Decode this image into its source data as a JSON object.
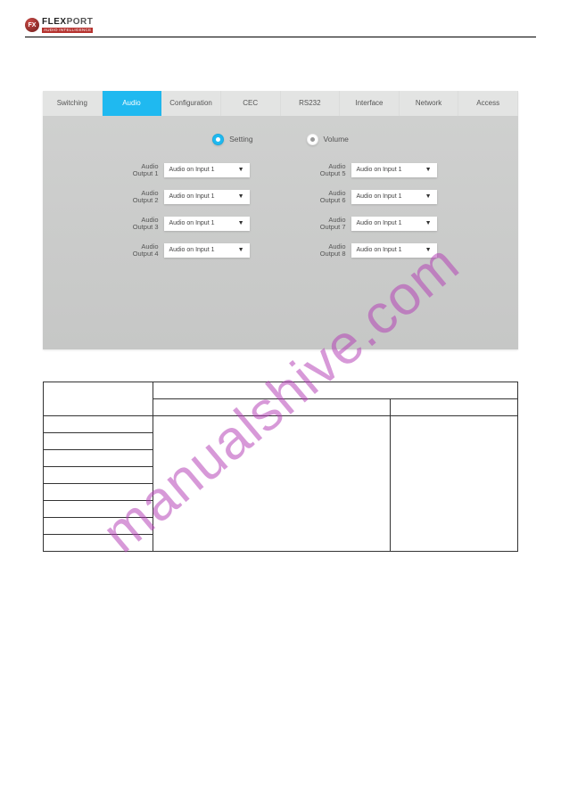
{
  "logo": {
    "icon_text": "FX",
    "name_bold": "FLEX",
    "name_light": "PORT",
    "subtitle": "AUDIO INTELLIGENCE"
  },
  "tabs": [
    {
      "label": "Switching",
      "active": false
    },
    {
      "label": "Audio",
      "active": true
    },
    {
      "label": "Configuration",
      "active": false
    },
    {
      "label": "CEC",
      "active": false
    },
    {
      "label": "RS232",
      "active": false
    },
    {
      "label": "Interface",
      "active": false
    },
    {
      "label": "Network",
      "active": false
    },
    {
      "label": "Access",
      "active": false
    }
  ],
  "subToggle": {
    "setting": "Setting",
    "volume": "Volume",
    "selected": "setting"
  },
  "outputs": {
    "left": [
      {
        "label": "Audio Output 1",
        "value": "Audio on Input 1"
      },
      {
        "label": "Audio Output 2",
        "value": "Audio on Input 1"
      },
      {
        "label": "Audio Output 3",
        "value": "Audio on Input 1"
      },
      {
        "label": "Audio Output 4",
        "value": "Audio on Input 1"
      }
    ],
    "right": [
      {
        "label": "Audio Output 5",
        "value": "Audio on Input 1"
      },
      {
        "label": "Audio Output 6",
        "value": "Audio on Input 1"
      },
      {
        "label": "Audio Output 7",
        "value": "Audio on Input 1"
      },
      {
        "label": "Audio Output 8",
        "value": "Audio on Input 1"
      }
    ]
  },
  "table": {
    "header1": "",
    "header2": "",
    "sub1": "",
    "sub2": "",
    "leftcells": [
      "",
      "",
      "",
      "",
      "",
      "",
      "",
      ""
    ]
  },
  "watermark": "manualshive.com"
}
